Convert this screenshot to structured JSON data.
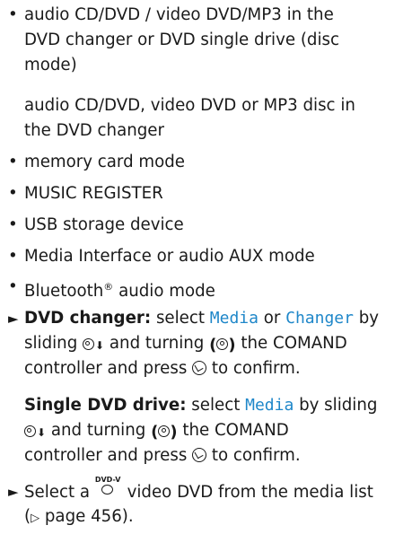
{
  "bullets_top": [
    {
      "lines": [
        "audio CD/DVD / video DVD/MP3 in the",
        "DVD changer or DVD single drive (disc",
        "mode)"
      ]
    }
  ],
  "continuation": [
    "audio CD/DVD, video DVD or MP3 disc in",
    "the DVD changer"
  ],
  "bullets": [
    {
      "text": "memory card mode"
    },
    {
      "text": "MUSIC REGISTER"
    },
    {
      "text": "USB storage device"
    },
    {
      "text": "Media Interface or audio AUX mode"
    },
    {
      "text": "Bluetooth",
      "sup": "®",
      "suffix": " audio mode"
    }
  ],
  "bullet_char": "•",
  "step_char": "►",
  "step1": {
    "bold": "DVD changer:",
    "select": " select ",
    "menu1": "Media",
    "or": " or ",
    "menu2": "Changer",
    "by": " by",
    "line2a": "sliding ",
    "line2b": " and turning ",
    "line2c": " the COMAND",
    "line3a": "controller and press ",
    "line3b": " to confirm."
  },
  "step1b": {
    "bold": "Single DVD drive:",
    "select": " select ",
    "menu": "Media",
    "by": " by sliding",
    "line2a": " and turning ",
    "line2b": " the COMAND",
    "line3a": "controller and press ",
    "line3b": " to confirm."
  },
  "step2": {
    "line1a": "Select a ",
    "icon_text": "DVD-V",
    "line1b": " video DVD from the media list",
    "ref_open": "(",
    "ref_arrow": "▷",
    "ref_text": " page 456).",
    "ref_close": ""
  },
  "colors": {
    "text": "#1a1a1a",
    "menu_highlight": "#1f87c9"
  },
  "icons": [
    "bullet-dot",
    "step-arrow-icon",
    "controller-slide-down-icon",
    "controller-turn-icon",
    "controller-press-icon",
    "dvd-video-icon",
    "page-reference-arrow-icon"
  ]
}
